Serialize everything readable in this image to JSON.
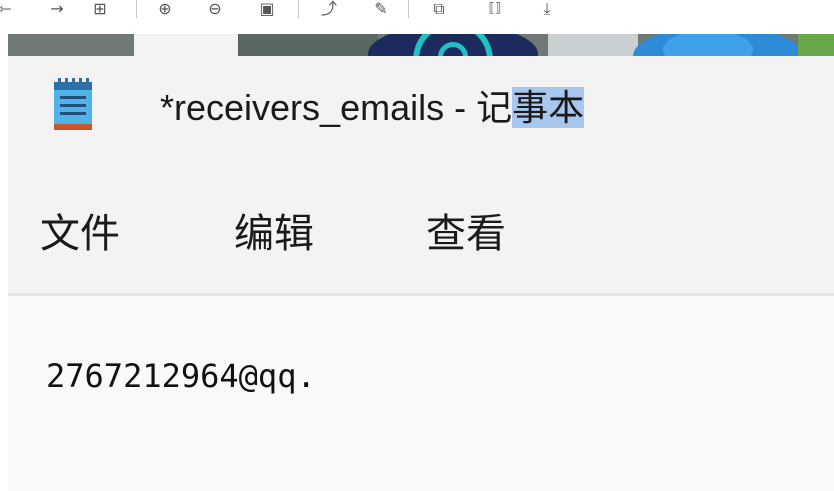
{
  "viewer_toolbar": {
    "icons": [
      {
        "name": "back-arrow-icon",
        "glyph": "⇽"
      },
      {
        "name": "forward-arrow-icon",
        "glyph": "→"
      },
      {
        "name": "grid-icon",
        "glyph": "⊞"
      },
      {
        "name": "zoom-in-icon",
        "glyph": "⊕"
      },
      {
        "name": "zoom-out-icon",
        "glyph": "⊖"
      },
      {
        "name": "fit-icon",
        "glyph": "▣"
      },
      {
        "name": "rotate-icon",
        "glyph": "⤴"
      },
      {
        "name": "edit-icon",
        "glyph": "✎"
      },
      {
        "name": "translate-icon",
        "glyph": "⧉"
      },
      {
        "name": "ocr-icon",
        "glyph": "⟦⟧"
      },
      {
        "name": "download-icon",
        "glyph": "⤓"
      }
    ]
  },
  "notepad": {
    "title_main": "*receivers_emails - 记",
    "title_highlight": "事本",
    "menu": {
      "file": "文件",
      "edit": "编辑",
      "view": "查看"
    },
    "content": "2767212964@qq."
  },
  "colors": {
    "window_bg": "#f3f3f3",
    "editor_bg": "#f9f9f9",
    "highlight": "#a7c7ee",
    "accent_teal": "#1fc2c0"
  }
}
